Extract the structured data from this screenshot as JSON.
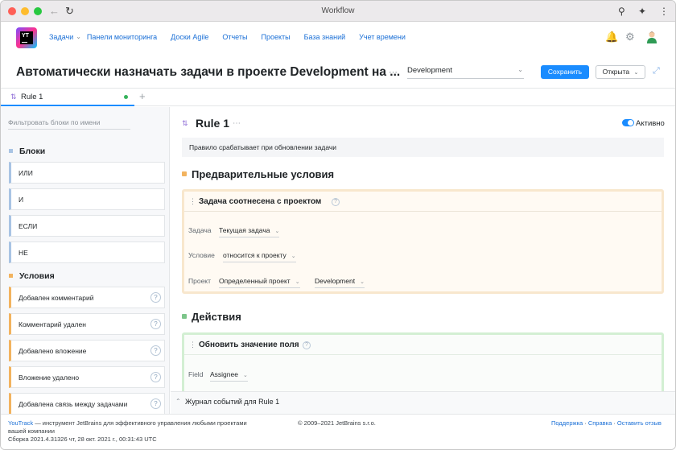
{
  "browser": {
    "title": "Workflow"
  },
  "nav": {
    "items": [
      "Задачи",
      "Панели мониторинга",
      "Доски Agile",
      "Отчеты",
      "Проекты",
      "База знаний",
      "Учет времени"
    ]
  },
  "logo": {
    "text": "YT"
  },
  "page": {
    "title": "Автоматически назначать задачи в проекте Development на ...",
    "project": "Development",
    "save_label": "Сохранить",
    "status_label": "Открыта"
  },
  "tab": {
    "label": "Rule 1"
  },
  "sidebar": {
    "filter_placeholder": "Фильтровать блоки по имени",
    "blocks_heading": "Блоки",
    "blocks": [
      "ИЛИ",
      "И",
      "ЕСЛИ",
      "НЕ"
    ],
    "conditions_heading": "Условия",
    "conditions": [
      "Добавлен комментарий",
      "Комментарий удален",
      "Добавлено вложение",
      "Вложение удалено",
      "Добавлена связь между задачами"
    ]
  },
  "rule": {
    "name": "Rule 1",
    "active_label": "Активно",
    "description": "Правило срабатывает при обновлении задачи",
    "preconditions_title": "Предварительные условия",
    "precondition_card": {
      "title": "Задача соотнесена с проектом",
      "task_label": "Задача",
      "task_value": "Текущая задача",
      "condition_label": "Условие",
      "condition_value": "относится к проекту",
      "project_label": "Проект",
      "project_value_1": "Определенный проект",
      "project_value_2": "Development"
    },
    "actions_title": "Действия",
    "action_card": {
      "title": "Обновить значение поля",
      "field_label": "Field",
      "field_value": "Assignee"
    }
  },
  "journal": {
    "label": "Журнал событий для Rule 1"
  },
  "footer": {
    "product": "YouTrack",
    "description": " — инструмент JetBrains для эффективного управления любыми проектами вашей компании",
    "build": "Сборка 2021.4.31326 чт, 28 окт. 2021 г., 00:31:43 UTC",
    "copyright": "© 2009–2021 JetBrains s.r.o.",
    "links": [
      "Поддержка",
      "Справка",
      "Оставить отзыв"
    ],
    "separator": " · "
  },
  "colors": {
    "accent": "#1a8cff",
    "preconditions": "#f2b35f",
    "actions": "#7cc58a"
  }
}
